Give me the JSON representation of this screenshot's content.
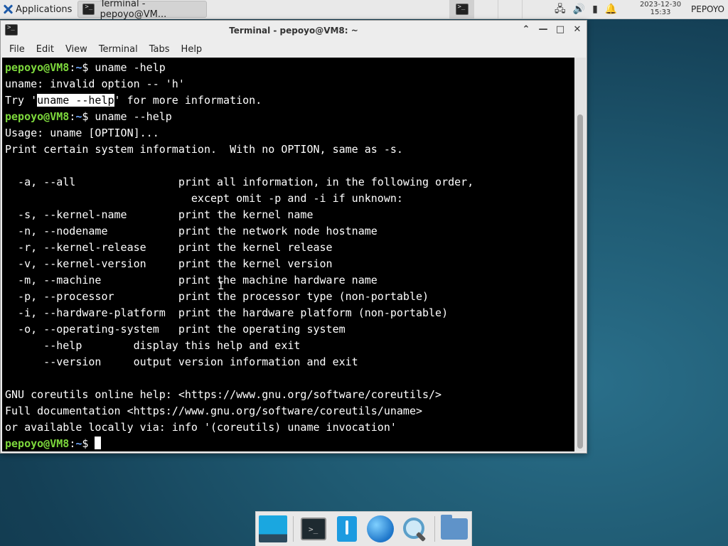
{
  "panel": {
    "applications_label": "Applications",
    "task_title": "Terminal - pepoyo@VM...",
    "clock_date": "2023-12-30",
    "clock_time": "15:33",
    "user": "PEPOYO"
  },
  "window": {
    "title": "Terminal - pepoyo@VM8: ~",
    "menu": [
      "File",
      "Edit",
      "View",
      "Terminal",
      "Tabs",
      "Help"
    ]
  },
  "terminal": {
    "prompt_user": "pepoyo@VM8",
    "prompt_path": "~",
    "cmd1": " uname -help",
    "err1": "uname: invalid option -- 'h'",
    "try_pre": "Try '",
    "try_hl": "uname --help",
    "try_post": "' for more information.",
    "cmd2": " uname --help",
    "output": [
      "Usage: uname [OPTION]...",
      "Print certain system information.  With no OPTION, same as -s.",
      "",
      "  -a, --all                print all information, in the following order,",
      "                             except omit -p and -i if unknown:",
      "  -s, --kernel-name        print the kernel name",
      "  -n, --nodename           print the network node hostname",
      "  -r, --kernel-release     print the kernel release",
      "  -v, --kernel-version     print the kernel version",
      "  -m, --machine            print the machine hardware name",
      "  -p, --processor          print the processor type (non-portable)",
      "  -i, --hardware-platform  print the hardware platform (non-portable)",
      "  -o, --operating-system   print the operating system",
      "      --help        display this help and exit",
      "      --version     output version information and exit",
      "",
      "GNU coreutils online help: <https://www.gnu.org/software/coreutils/>",
      "Full documentation <https://www.gnu.org/software/coreutils/uname>",
      "or available locally via: info '(coreutils) uname invocation'"
    ]
  }
}
